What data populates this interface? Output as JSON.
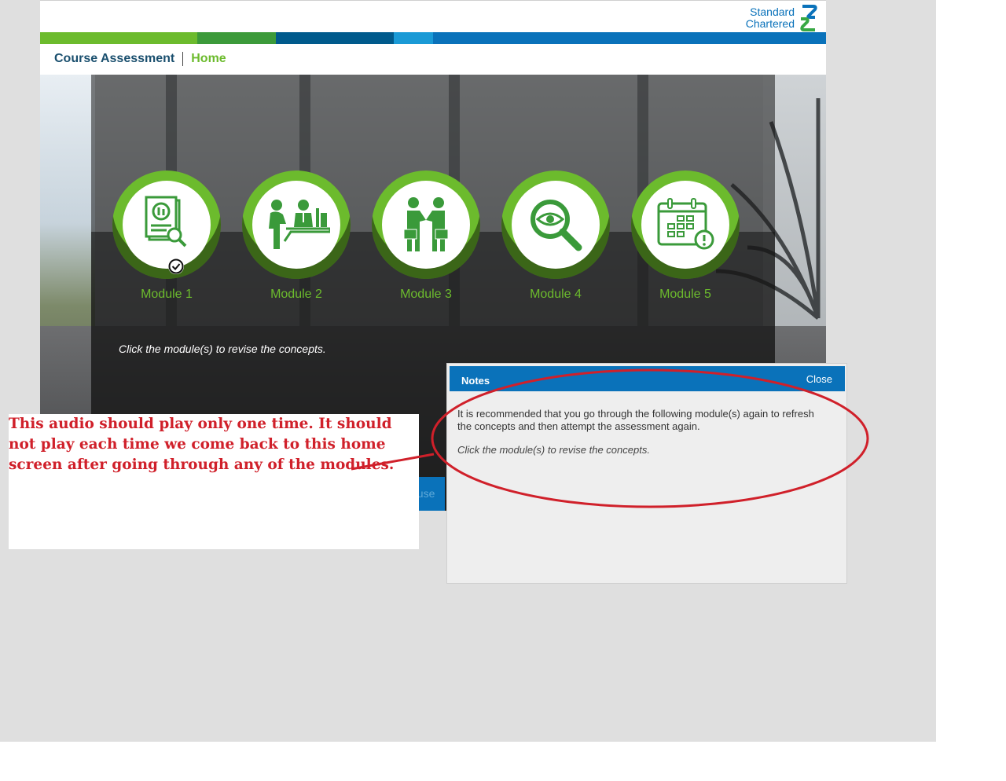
{
  "logo": {
    "line1": "Standard",
    "line2": "Chartered"
  },
  "colors": {
    "green": "#6cbb2d",
    "blue": "#0a72ba",
    "annotation_red": "#d0202a"
  },
  "color_bar": [
    "#6cbb2d",
    "#3c9a3a",
    "#005a8c",
    "#1a9ad6",
    "#0a72ba"
  ],
  "breadcrumb": {
    "course": "Course Assessment",
    "current": "Home"
  },
  "modules": [
    {
      "label": "Module 1",
      "icon": "report-magnifier-icon",
      "completed": true
    },
    {
      "label": "Module 2",
      "icon": "meeting-desk-icon",
      "completed": false
    },
    {
      "label": "Module 3",
      "icon": "handshake-icon",
      "completed": false
    },
    {
      "label": "Module 4",
      "icon": "eye-magnifier-icon",
      "completed": false
    },
    {
      "label": "Module 5",
      "icon": "calendar-alert-icon",
      "completed": false
    }
  ],
  "instruction": "Click the module(s) to revise the concepts.",
  "partial_button_text": "ause",
  "notes": {
    "title": "Notes",
    "close_label": "Close",
    "paragraph1": "It is recommended that you go through the following module(s) again to refresh the concepts and then attempt the assessment again.",
    "paragraph2": "Click the module(s) to revise the concepts."
  },
  "annotation": {
    "text": "This audio should play only one time. It should not play each time we come back to this home screen after going through any of the modules."
  }
}
